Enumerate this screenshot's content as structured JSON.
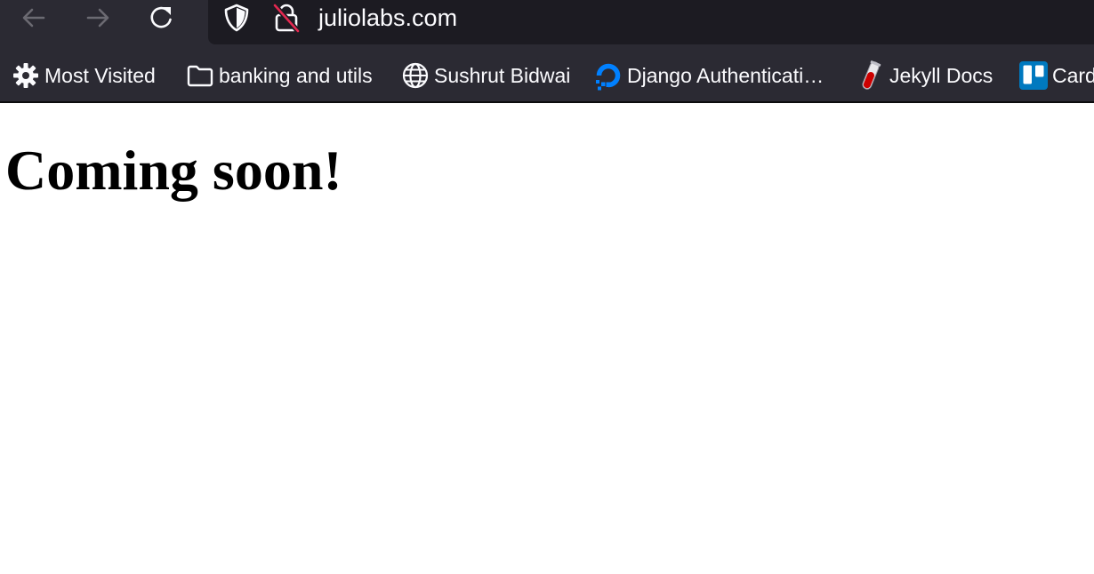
{
  "toolbar": {
    "back_icon": "arrow-left-icon",
    "forward_icon": "arrow-right-icon",
    "reload_icon": "reload-icon"
  },
  "url_bar": {
    "shield_icon": "shield-icon",
    "insecure_lock_icon": "lock-slash-icon",
    "url": "juliolabs.com"
  },
  "bookmarks": [
    {
      "label": "Most Visited",
      "icon": "gear-icon"
    },
    {
      "label": "banking and utils",
      "icon": "folder-icon"
    },
    {
      "label": "Sushrut Bidwai",
      "icon": "globe-icon"
    },
    {
      "label": "Django Authenticati…",
      "icon": "digitalocean-icon"
    },
    {
      "label": "Jekyll Docs",
      "icon": "test-tube-icon"
    },
    {
      "label": "Card",
      "icon": "trello-icon"
    }
  ],
  "page": {
    "heading": "Coming soon!"
  },
  "colors": {
    "toolbar_bg": "#2b2a33",
    "url_bar_bg": "#1c1b22",
    "toolbar_text": "#fbfbfe",
    "insecure_slash": "#e22850",
    "digitalocean_blue": "#0080ff",
    "trello_blue": "#0079bf",
    "jekyll_red": "#cc0000"
  }
}
